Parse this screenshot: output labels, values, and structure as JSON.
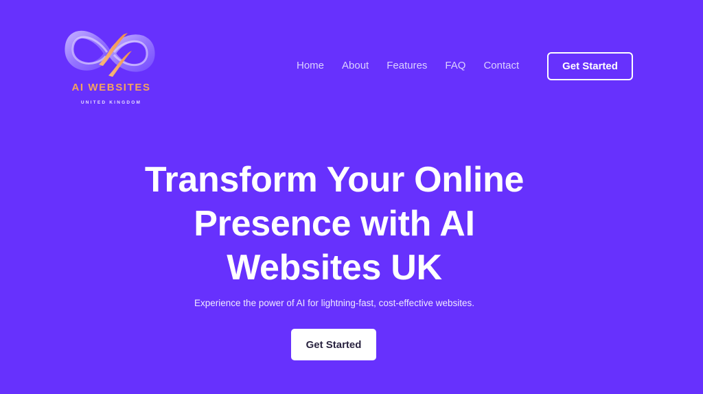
{
  "colors": {
    "background": "#6731fd",
    "brand_orange": "#f4a35f",
    "logo_purple": "#a98cff",
    "text": "#ffffff"
  },
  "logo": {
    "icon": "infinity-swirl-logo-icon",
    "title": "AI WEBSITES",
    "subtitle": "UNITED KINGDOM"
  },
  "nav": {
    "items": [
      {
        "label": "Home"
      },
      {
        "label": "About"
      },
      {
        "label": "Features"
      },
      {
        "label": "FAQ"
      },
      {
        "label": "Contact"
      }
    ],
    "cta_label": "Get Started"
  },
  "hero": {
    "title_lines": [
      "Transform Your Online",
      "Presence with AI",
      "Websites UK"
    ],
    "subtitle": "Experience the power of AI for lightning-fast, cost-effective websites.",
    "cta_label": "Get Started"
  }
}
